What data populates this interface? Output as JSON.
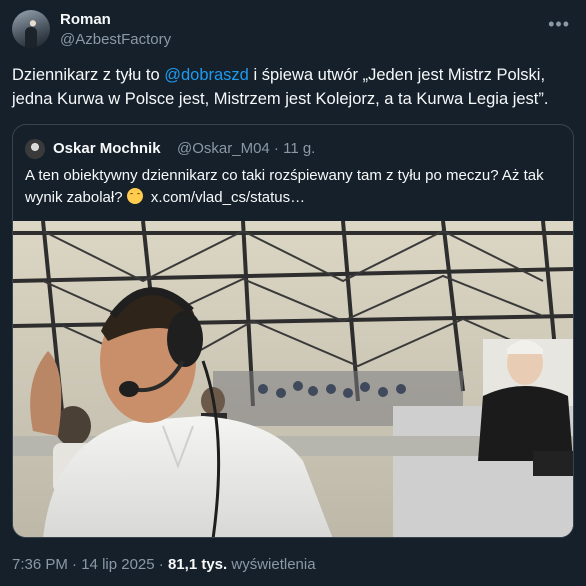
{
  "author": {
    "display_name": "Roman",
    "handle": "@AzbestFactory"
  },
  "tweet": {
    "text_before": "Dziennikarz z tyłu to ",
    "mention": "@dobraszd",
    "text_after": " i śpiewa utwór „Jeden jest Mistrz Polski, jedna Kurwa w Polsce jest, Mistrzem jest Kolejorz, a ta Kurwa Legia jest”."
  },
  "quote": {
    "display_name": "Oskar Mochnik",
    "meta": "@Oskar_M04 · 11 g.",
    "text": "A ten obiektywny dziennikarz co taki rozśpiewany tam z tyłu po meczu? Aż tak wynik zabolał?",
    "link": "x.com/vlad_cs/status…"
  },
  "footer": {
    "time": "7:36 PM",
    "date": "14 lip 2025",
    "separator": "·",
    "views_count": "81,1 tys.",
    "views_label": "wyświetlenia"
  },
  "icons": {
    "more": "more-dots-icon",
    "emoji": "upside-down-face-emoji"
  }
}
